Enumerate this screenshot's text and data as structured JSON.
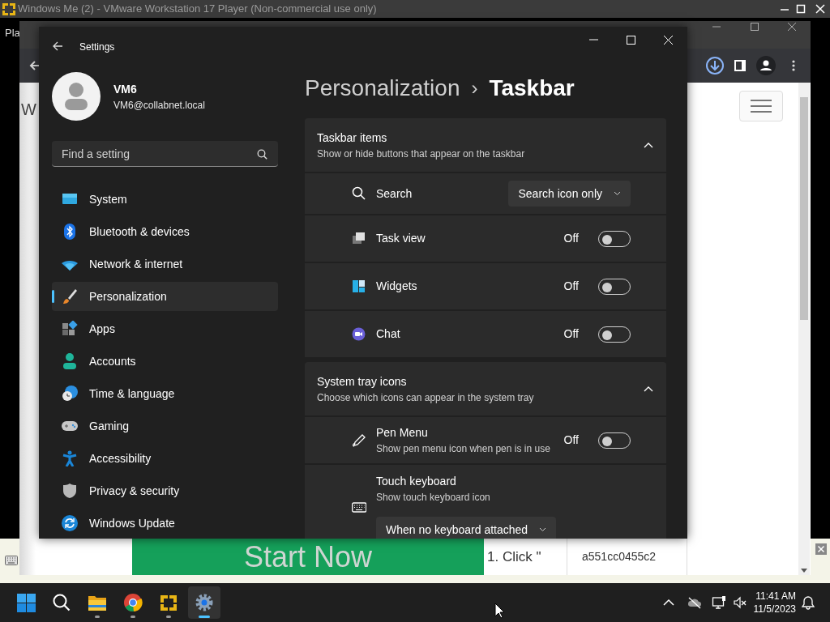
{
  "vmware": {
    "title": "Windows Me (2) - VMware Workstation 17 Player (Non-commercial use only)",
    "menu_label": "Pla"
  },
  "browser": {
    "page_heading": "W",
    "ad_banner": "Start Now",
    "step_text": "1. Click \"",
    "hash_cell": "a551cc0455c2"
  },
  "settings": {
    "title": "Settings",
    "user": {
      "name": "VM6",
      "email": "VM6@collabnet.local"
    },
    "search": {
      "placeholder": "Find a setting"
    },
    "nav": [
      {
        "kind": "system",
        "label": "System",
        "selected": false
      },
      {
        "kind": "bluetooth",
        "label": "Bluetooth & devices",
        "selected": false
      },
      {
        "kind": "network",
        "label": "Network & internet",
        "selected": false
      },
      {
        "kind": "personalization",
        "label": "Personalization",
        "selected": true
      },
      {
        "kind": "apps",
        "label": "Apps",
        "selected": false
      },
      {
        "kind": "accounts",
        "label": "Accounts",
        "selected": false
      },
      {
        "kind": "time",
        "label": "Time & language",
        "selected": false
      },
      {
        "kind": "gaming",
        "label": "Gaming",
        "selected": false
      },
      {
        "kind": "accessibility",
        "label": "Accessibility",
        "selected": false
      },
      {
        "kind": "privacy",
        "label": "Privacy & security",
        "selected": false
      },
      {
        "kind": "update",
        "label": "Windows Update",
        "selected": false
      }
    ],
    "breadcrumb": {
      "parent": "Personalization",
      "separator": "›",
      "current": "Taskbar"
    },
    "sections": [
      {
        "title": "Taskbar items",
        "subtitle": "Show or hide buttons that appear on the taskbar",
        "expanded": true,
        "rows": [
          {
            "kind": "dropdown",
            "label": "Search",
            "value": "Search icon only"
          },
          {
            "kind": "toggle",
            "label": "Task view",
            "state_text": "Off",
            "on": false
          },
          {
            "kind": "toggle",
            "label": "Widgets",
            "state_text": "Off",
            "on": false
          },
          {
            "kind": "toggle",
            "label": "Chat",
            "state_text": "Off",
            "on": false
          }
        ]
      },
      {
        "title": "System tray icons",
        "subtitle": "Choose which icons can appear in the system tray",
        "expanded": true,
        "rows": [
          {
            "kind": "toggle",
            "label": "Pen Menu",
            "description": "Show pen menu icon when pen is in use",
            "state_text": "Off",
            "on": false
          },
          {
            "kind": "dropdown_below",
            "label": "Touch keyboard",
            "description": "Show touch keyboard icon",
            "value": "When no keyboard attached"
          }
        ]
      }
    ]
  },
  "taskbar": {
    "apps": [
      {
        "kind": "start",
        "running": false,
        "active": false
      },
      {
        "kind": "search",
        "running": false,
        "active": false
      },
      {
        "kind": "explorer",
        "running": true,
        "active": false
      },
      {
        "kind": "chrome",
        "running": true,
        "active": false
      },
      {
        "kind": "vmware",
        "running": true,
        "active": false
      },
      {
        "kind": "settings",
        "running": true,
        "active": true
      }
    ],
    "clock": {
      "time": "11:41 AM",
      "date": "11/5/2023"
    }
  }
}
